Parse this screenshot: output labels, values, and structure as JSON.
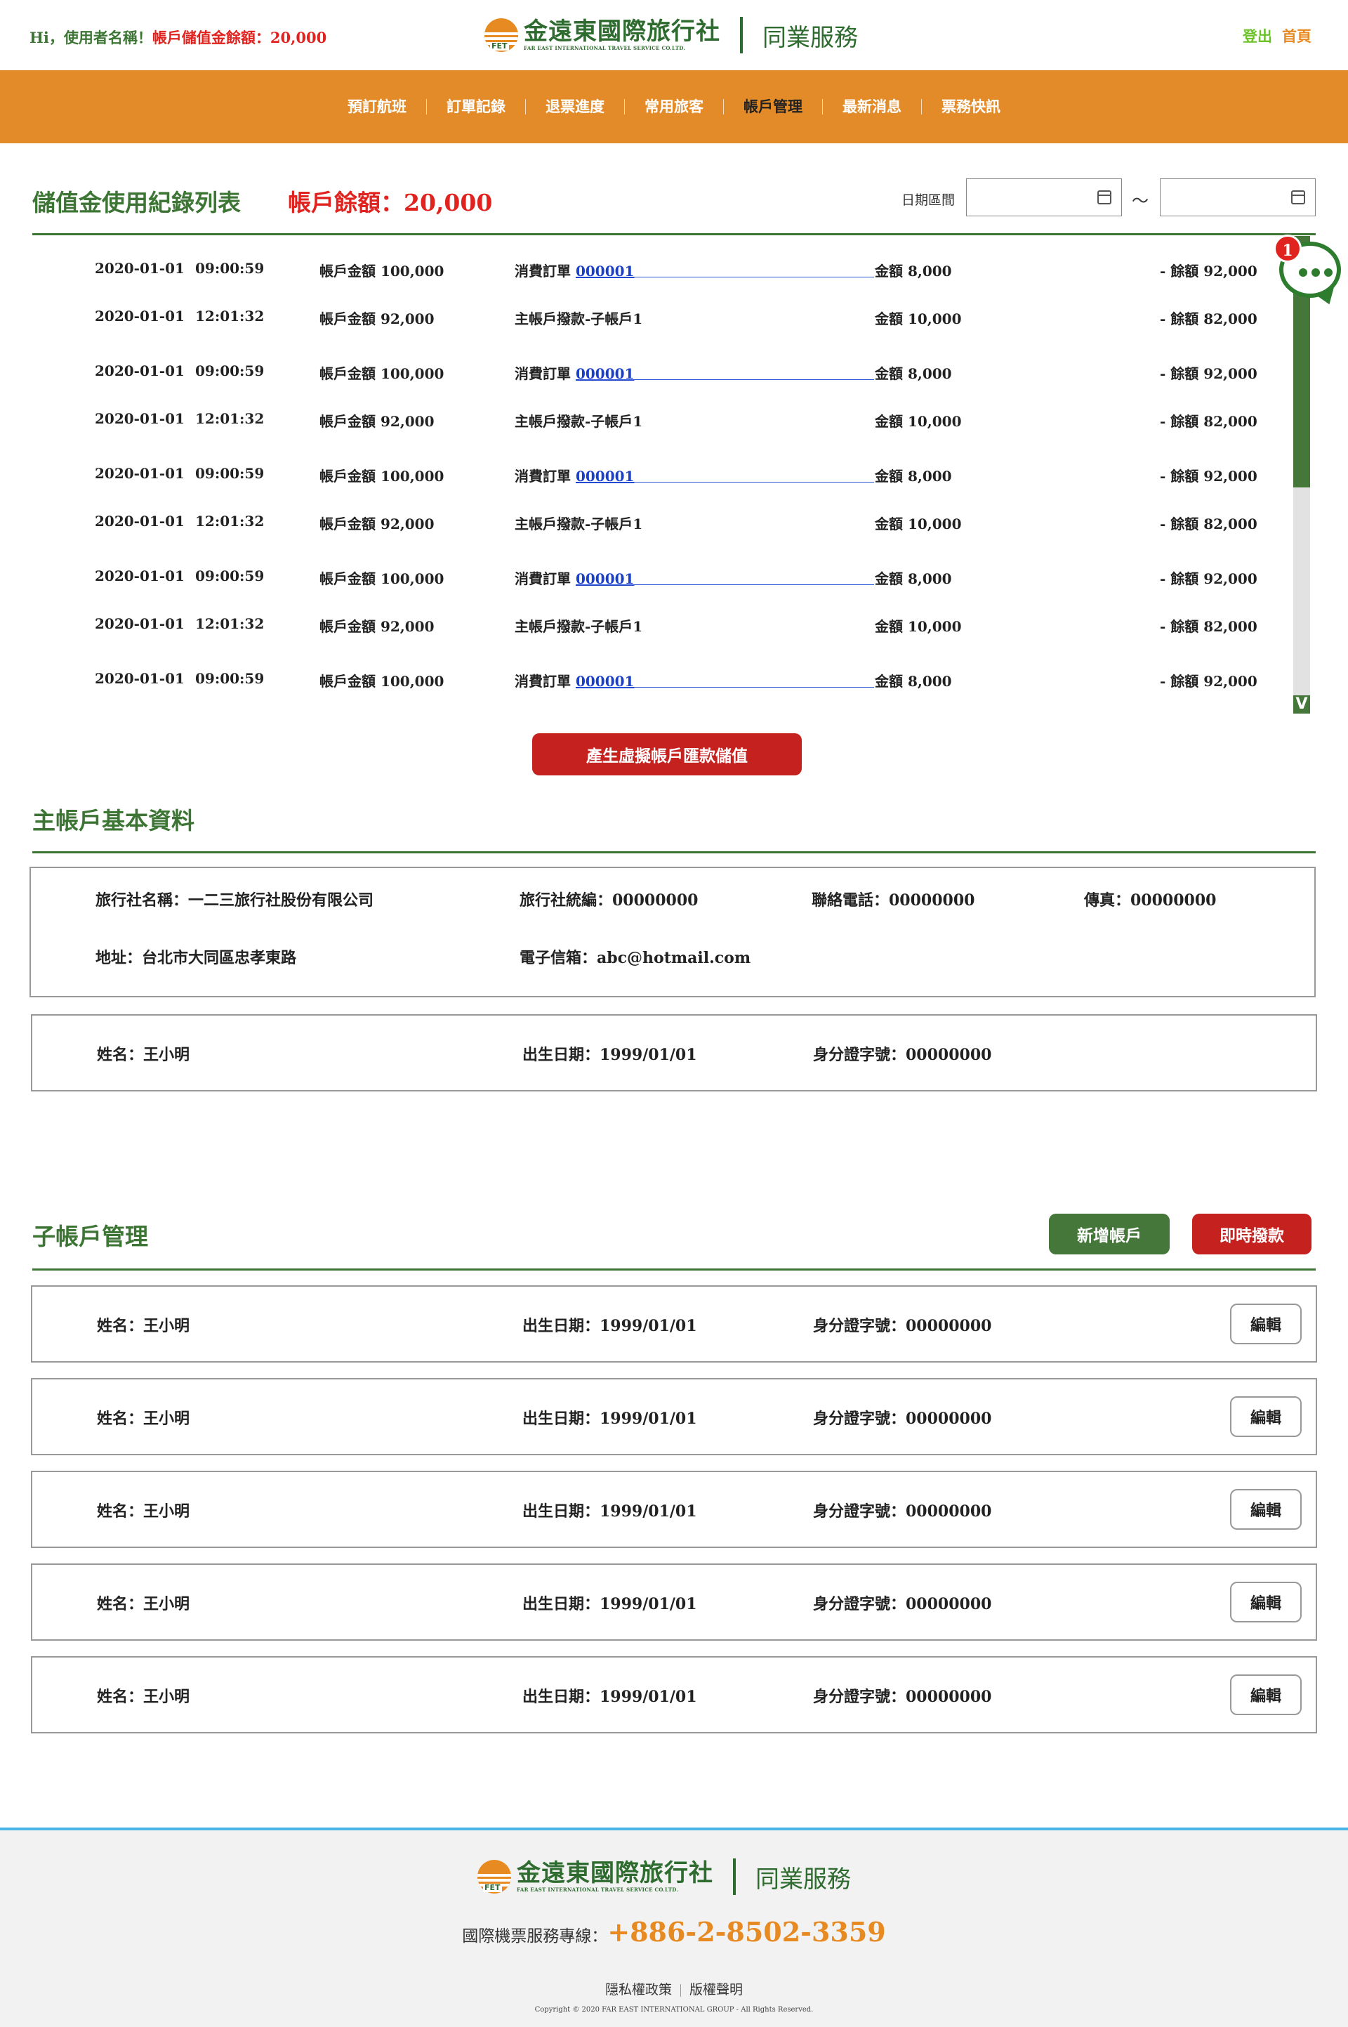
{
  "header": {
    "greeting_prefix": "Hi，使用者名稱！",
    "greeting_balance": "帳戶儲值金餘額：20,000",
    "logo_cn": "金遠東國際旅行社",
    "logo_en": "FAR EAST INTERNATIONAL TRAVEL SERVICE CO.LTD.",
    "logo_badge": "FET",
    "service_name": "同業服務",
    "logout_label": "登出",
    "home_label": "首頁"
  },
  "nav": {
    "items": [
      {
        "label": "預訂航班",
        "active": false
      },
      {
        "label": "訂單記錄",
        "active": false
      },
      {
        "label": "退票進度",
        "active": false
      },
      {
        "label": "常用旅客",
        "active": false
      },
      {
        "label": "帳戶管理",
        "active": true
      },
      {
        "label": "最新消息",
        "active": false
      },
      {
        "label": "票務快訊",
        "active": false
      }
    ]
  },
  "records_section": {
    "title": "儲值金使用紀錄列表",
    "balance": "帳戶餘額：20,000",
    "date_label": "日期區間",
    "date_sep": "～",
    "rows": [
      {
        "date": "2020-01-01",
        "time": "09:00:59",
        "account": "帳戶金額 100,000",
        "desc": "消費訂單",
        "order": "000001",
        "amount": "金額 8,000",
        "remain": "-  餘額 92,000"
      },
      {
        "date": "2020-01-01",
        "time": "12:01:32",
        "account": "帳戶金額 92,000",
        "desc": "主帳戶撥款-子帳戶1",
        "order": "",
        "amount": "金額 10,000",
        "remain": "-  餘額 82,000"
      },
      {
        "date": "2020-01-01",
        "time": "09:00:59",
        "account": "帳戶金額 100,000",
        "desc": "消費訂單",
        "order": "000001",
        "amount": "金額 8,000",
        "remain": "-  餘額 92,000"
      },
      {
        "date": "2020-01-01",
        "time": "12:01:32",
        "account": "帳戶金額 92,000",
        "desc": "主帳戶撥款-子帳戶1",
        "order": "",
        "amount": "金額 10,000",
        "remain": "-  餘額 82,000"
      },
      {
        "date": "2020-01-01",
        "time": "09:00:59",
        "account": "帳戶金額 100,000",
        "desc": "消費訂單",
        "order": "000001",
        "amount": "金額 8,000",
        "remain": "-  餘額 92,000"
      },
      {
        "date": "2020-01-01",
        "time": "12:01:32",
        "account": "帳戶金額 92,000",
        "desc": "主帳戶撥款-子帳戶1",
        "order": "",
        "amount": "金額 10,000",
        "remain": "-  餘額 82,000"
      },
      {
        "date": "2020-01-01",
        "time": "09:00:59",
        "account": "帳戶金額 100,000",
        "desc": "消費訂單",
        "order": "000001",
        "amount": "金額 8,000",
        "remain": "-  餘額 92,000"
      },
      {
        "date": "2020-01-01",
        "time": "12:01:32",
        "account": "帳戶金額 92,000",
        "desc": "主帳戶撥款-子帳戶1",
        "order": "",
        "amount": "金額 10,000",
        "remain": "-  餘額 82,000"
      },
      {
        "date": "2020-01-01",
        "time": "09:00:59",
        "account": "帳戶金額 100,000",
        "desc": "消費訂單",
        "order": "000001",
        "amount": "金額 8,000",
        "remain": "-  餘額 92,000"
      }
    ],
    "scroll_arrow": "V",
    "generate_button": "產生虛擬帳戶匯款儲值"
  },
  "chat": {
    "badge": "1"
  },
  "main_account": {
    "title": "主帳戶基本資料",
    "agency_name": "旅行社名稱：一二三旅行社股份有限公司",
    "tax_id": "旅行社統編：00000000",
    "phone": "聯絡電話：00000000",
    "fax": "傳真：00000000",
    "address": "地址：台北市大同區忠孝東路",
    "email": "電子信箱：abc@hotmail.com",
    "person_name": "姓名：王小明",
    "person_birth": "出生日期：1999/01/01",
    "person_id": "身分證字號：00000000"
  },
  "sub_accounts": {
    "title": "子帳戶管理",
    "add_button": "新增帳戶",
    "transfer_button": "即時撥款",
    "edit_label": "編輯",
    "rows": [
      {
        "name": "姓名：王小明",
        "birth": "出生日期：1999/01/01",
        "id": "身分證字號：00000000"
      },
      {
        "name": "姓名：王小明",
        "birth": "出生日期：1999/01/01",
        "id": "身分證字號：00000000"
      },
      {
        "name": "姓名：王小明",
        "birth": "出生日期：1999/01/01",
        "id": "身分證字號：00000000"
      },
      {
        "name": "姓名：王小明",
        "birth": "出生日期：1999/01/01",
        "id": "身分證字號：00000000"
      },
      {
        "name": "姓名：王小明",
        "birth": "出生日期：1999/01/01",
        "id": "身分證字號：00000000"
      }
    ]
  },
  "footer": {
    "hotline_label": "國際機票服務專線：",
    "hotline_number": "+886-2-8502-3359",
    "privacy": "隱私權政策",
    "copyright_link": "版權聲明",
    "copyright": "Copyright © 2020 FAR EAST INTERNATIONAL GROUP - All Rights Reserved."
  },
  "colors": {
    "brand_green": "#3d7535",
    "brand_orange": "#e38b28",
    "alert_red": "#e0231e",
    "link_blue": "#1a3fc9"
  }
}
